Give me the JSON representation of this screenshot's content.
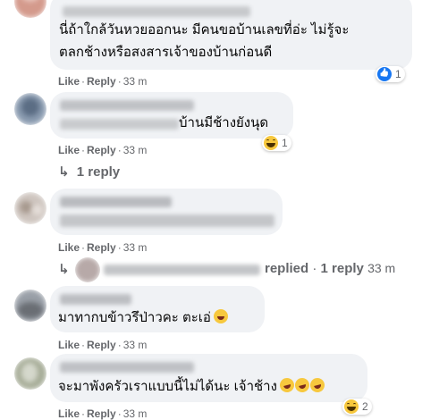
{
  "comments": [
    {
      "text_line1": "นี่ถ้าใกล้วันหวยออกนะ มีคนขอบ้านเลขที่อ่ะ ไม่รู้จะ",
      "text_line2": "ตลกช้างหรือสงสารเจ้าของบ้านก่อนดี",
      "like": "Like",
      "reply": "Reply",
      "time": "33 m",
      "reaction_icon": "like-reaction",
      "reaction_count": "1"
    },
    {
      "text": "บ้านมีช้างยังนุด",
      "like": "Like",
      "reply": "Reply",
      "time": "33 m",
      "reaction_icon": "haha-reaction",
      "reaction_count": "1",
      "replies_link": "1 reply"
    },
    {
      "like": "Like",
      "reply": "Reply",
      "time": "33 m",
      "replied_label": "replied",
      "replied_count": "1 reply",
      "replied_time": "33 m"
    },
    {
      "text": "มาทากบข้าวรึป่าวคะ ตะเอ่",
      "like": "Like",
      "reply": "Reply",
      "time": "33 m"
    },
    {
      "text": "จะมาพังครัวเราแบบนี้ไม่ได้นะ เจ้าช้าง",
      "like": "Like",
      "reply": "Reply",
      "time": "33 m",
      "reaction_icon": "haha-reaction",
      "reaction_count": "2"
    }
  ],
  "separator": "·",
  "reply_arrow": "↳"
}
